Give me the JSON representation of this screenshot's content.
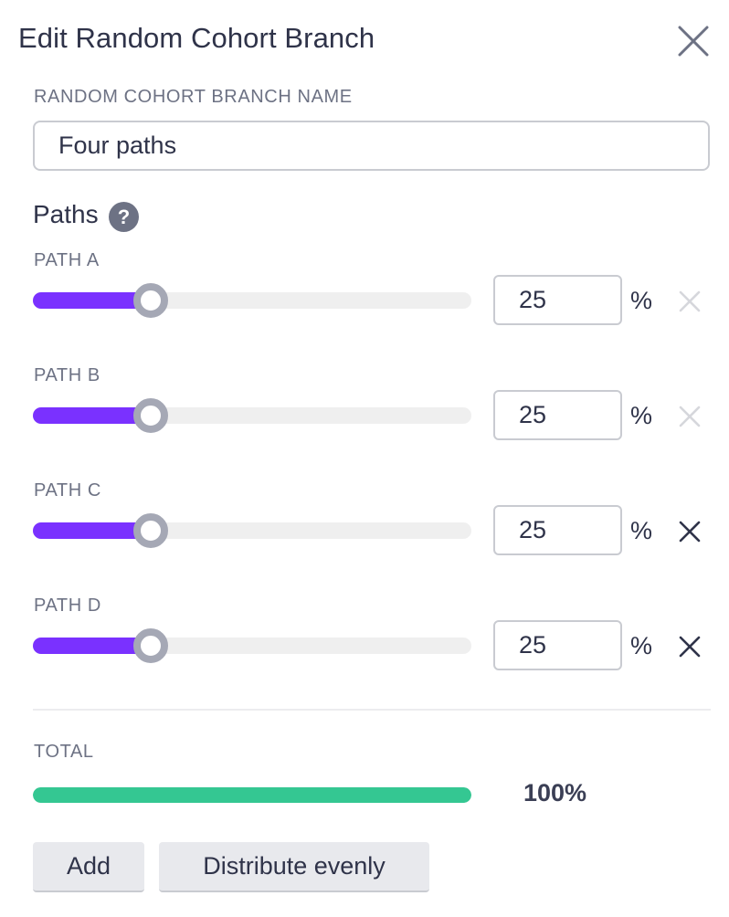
{
  "dialog": {
    "title": "Edit Random Cohort Branch",
    "close_icon": "close-icon"
  },
  "name_field": {
    "label": "RANDOM COHORT BRANCH NAME",
    "value": "Four paths"
  },
  "paths_section": {
    "heading": "Paths",
    "help_icon": "?",
    "unit": "%",
    "paths": [
      {
        "label": "PATH A",
        "value": "25",
        "percent": 25,
        "removable": false
      },
      {
        "label": "PATH B",
        "value": "25",
        "percent": 25,
        "removable": false
      },
      {
        "label": "PATH C",
        "value": "25",
        "percent": 25,
        "removable": true
      },
      {
        "label": "PATH D",
        "value": "25",
        "percent": 25,
        "removable": true
      }
    ]
  },
  "total": {
    "label": "TOTAL",
    "value": "100%",
    "percent": 100
  },
  "buttons": {
    "add": "Add",
    "distribute": "Distribute evenly"
  },
  "colors": {
    "slider_fill": "#7a31ff",
    "total_fill": "#34c792",
    "remove_enabled": "#2f3349",
    "remove_disabled": "#d6d7dc"
  }
}
